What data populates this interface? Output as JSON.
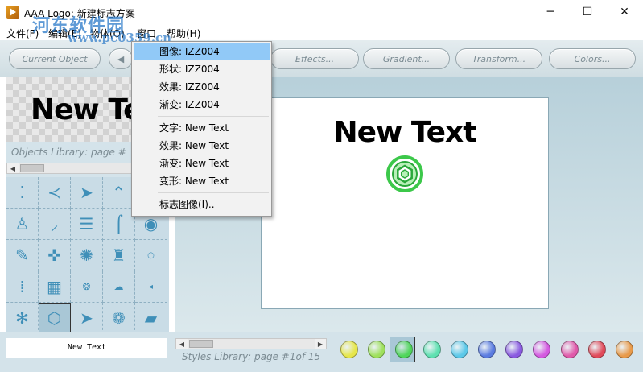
{
  "window": {
    "title": "AAA Logo: 新建标志方案",
    "minimize": "─",
    "maximize": "☐",
    "close": "✕"
  },
  "watermark": {
    "text": "河东软件园",
    "url": "www.pc0359.cn"
  },
  "menubar": {
    "items": [
      "文件(F)",
      "编辑(E)",
      "物体(O)",
      "窗口",
      "帮助(H)"
    ]
  },
  "toolbar": {
    "current_object": "Current Object",
    "arrow_left": "◀",
    "effects": "Effects...",
    "gradient": "Gradient...",
    "transform": "Transform...",
    "colors": "Colors..."
  },
  "left_panel": {
    "preview_text": "New Text",
    "objects_library_label": "Objects Library: page #",
    "scroll_left": "◀",
    "scroll_right": "▶"
  },
  "canvas": {
    "text": "New Text"
  },
  "bottom": {
    "text_input_value": "New Text",
    "styles_library_label": "Styles Library: page #1of 15",
    "scroll_left": "◀",
    "scroll_right": "▶",
    "swatches": [
      "#e6e64a",
      "#9ee05c",
      "#4fd65a",
      "#5ee0b0",
      "#5cc8e8",
      "#5a7be0",
      "#8a5ae0",
      "#d45ae0",
      "#e05aaa",
      "#e04a5a",
      "#e89a4a"
    ]
  },
  "dropdown": {
    "items": [
      {
        "label": "图像: IZZ004",
        "highlight": true
      },
      {
        "label": "形状: IZZ004"
      },
      {
        "label": "效果: IZZ004"
      },
      {
        "label": "渐变: IZZ004"
      },
      {
        "label": "文字: New Text"
      },
      {
        "label": "效果: New Text"
      },
      {
        "label": "渐变: New Text"
      },
      {
        "label": "变形: New Text"
      },
      {
        "label": "标志图像(I).."
      }
    ]
  },
  "icons": {
    "grid": [
      "dots-icon",
      "k-arrow-icon",
      "play-arrow-icon",
      "chevron-shape-icon",
      "ring-icon",
      "human-figure-icon",
      "slash-icon",
      "lines-icon",
      "curve-icon",
      "target-icon",
      "pencil-icon",
      "cross-pattern-icon",
      "gear-flower-icon",
      "figure-icon",
      "small-dot-icon",
      "dot-grid-icon",
      "checker-icon",
      "swirl-icon",
      "cloud-icon",
      "triangle-left-icon",
      "pinwheel-icon",
      "hexagon-ring-icon",
      "arrow-right-icon",
      "circles-icon",
      "ribbon-icon"
    ]
  },
  "colors": {
    "accent": "#91c9f7",
    "logo_green": "#3cc84a"
  }
}
